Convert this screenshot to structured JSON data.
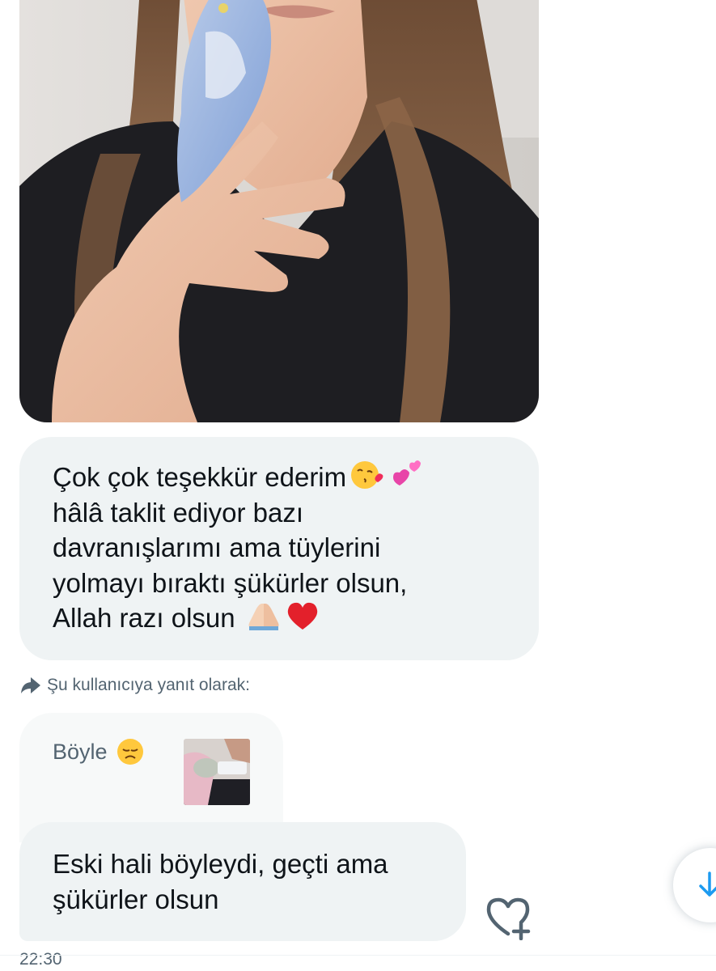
{
  "messages": {
    "main_text": {
      "line1": "Çok çok teşekkür ederim",
      "line2": "hâlâ taklit ediyor bazı",
      "line3": "davranışlarımı ama tüylerini",
      "line4": "yolmayı bıraktı şükürler olsun,",
      "line5": "Allah razı olsun"
    },
    "reply_context_label": "Şu kullanıcıya yanıt olarak:",
    "quoted_text": "Böyle",
    "last_message": {
      "line1": "Eski hali böyleydi, geçti ama",
      "line2": "şükürler olsun"
    },
    "timestamp": "22:30"
  },
  "icons": {
    "reply_context": "reply-arrow-icon",
    "heart_add": "heart-plus-icon",
    "scroll_down": "arrow-down-icon",
    "emoji_kiss": "face-blowing-kiss-emoji",
    "emoji_hearts": "two-hearts-emoji",
    "emoji_pray": "folded-hands-emoji",
    "emoji_heart": "red-heart-emoji",
    "emoji_sad": "disappointed-face-emoji"
  },
  "colors": {
    "bubble_bg": "#eff3f4",
    "text_primary": "#0f1419",
    "text_secondary": "#536471",
    "accent": "#1d9bf0"
  }
}
